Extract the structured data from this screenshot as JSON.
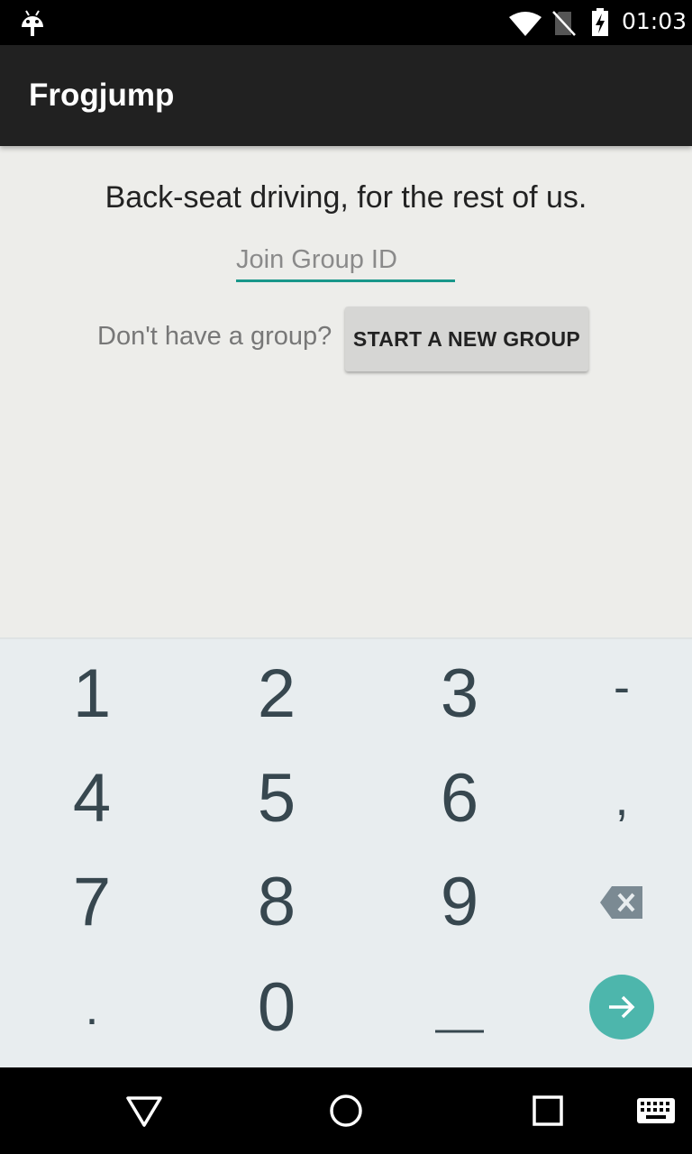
{
  "status_bar": {
    "time": "01:03"
  },
  "app_bar": {
    "title": "Frogjump"
  },
  "main": {
    "tagline": "Back-seat driving, for the rest of us.",
    "group_input_placeholder": "Join Group ID",
    "group_input_value": "",
    "no_group_text": "Don't have a group?",
    "start_button_label": "START A NEW GROUP"
  },
  "keyboard": {
    "keys": [
      "1",
      "2",
      "3",
      "-",
      "4",
      "5",
      "6",
      ",",
      "7",
      "8",
      "9",
      "⌫",
      ".",
      "0",
      "_",
      "→"
    ],
    "row1": [
      "1",
      "2",
      "3",
      "-"
    ],
    "row2": [
      "4",
      "5",
      "6",
      ","
    ],
    "row3": [
      "7",
      "8",
      "9"
    ],
    "row4": [
      ".",
      "0"
    ]
  },
  "colors": {
    "accent": "#19978a",
    "go_button": "#4db6ac",
    "app_bar": "#212121",
    "key_text": "#37474f"
  },
  "icons": [
    "android-debug-icon",
    "wifi-icon",
    "no-sim-icon",
    "battery-charging-icon",
    "backspace-icon",
    "go-arrow-icon",
    "back-nav-icon",
    "home-nav-icon",
    "recents-nav-icon",
    "keyboard-switch-icon"
  ]
}
